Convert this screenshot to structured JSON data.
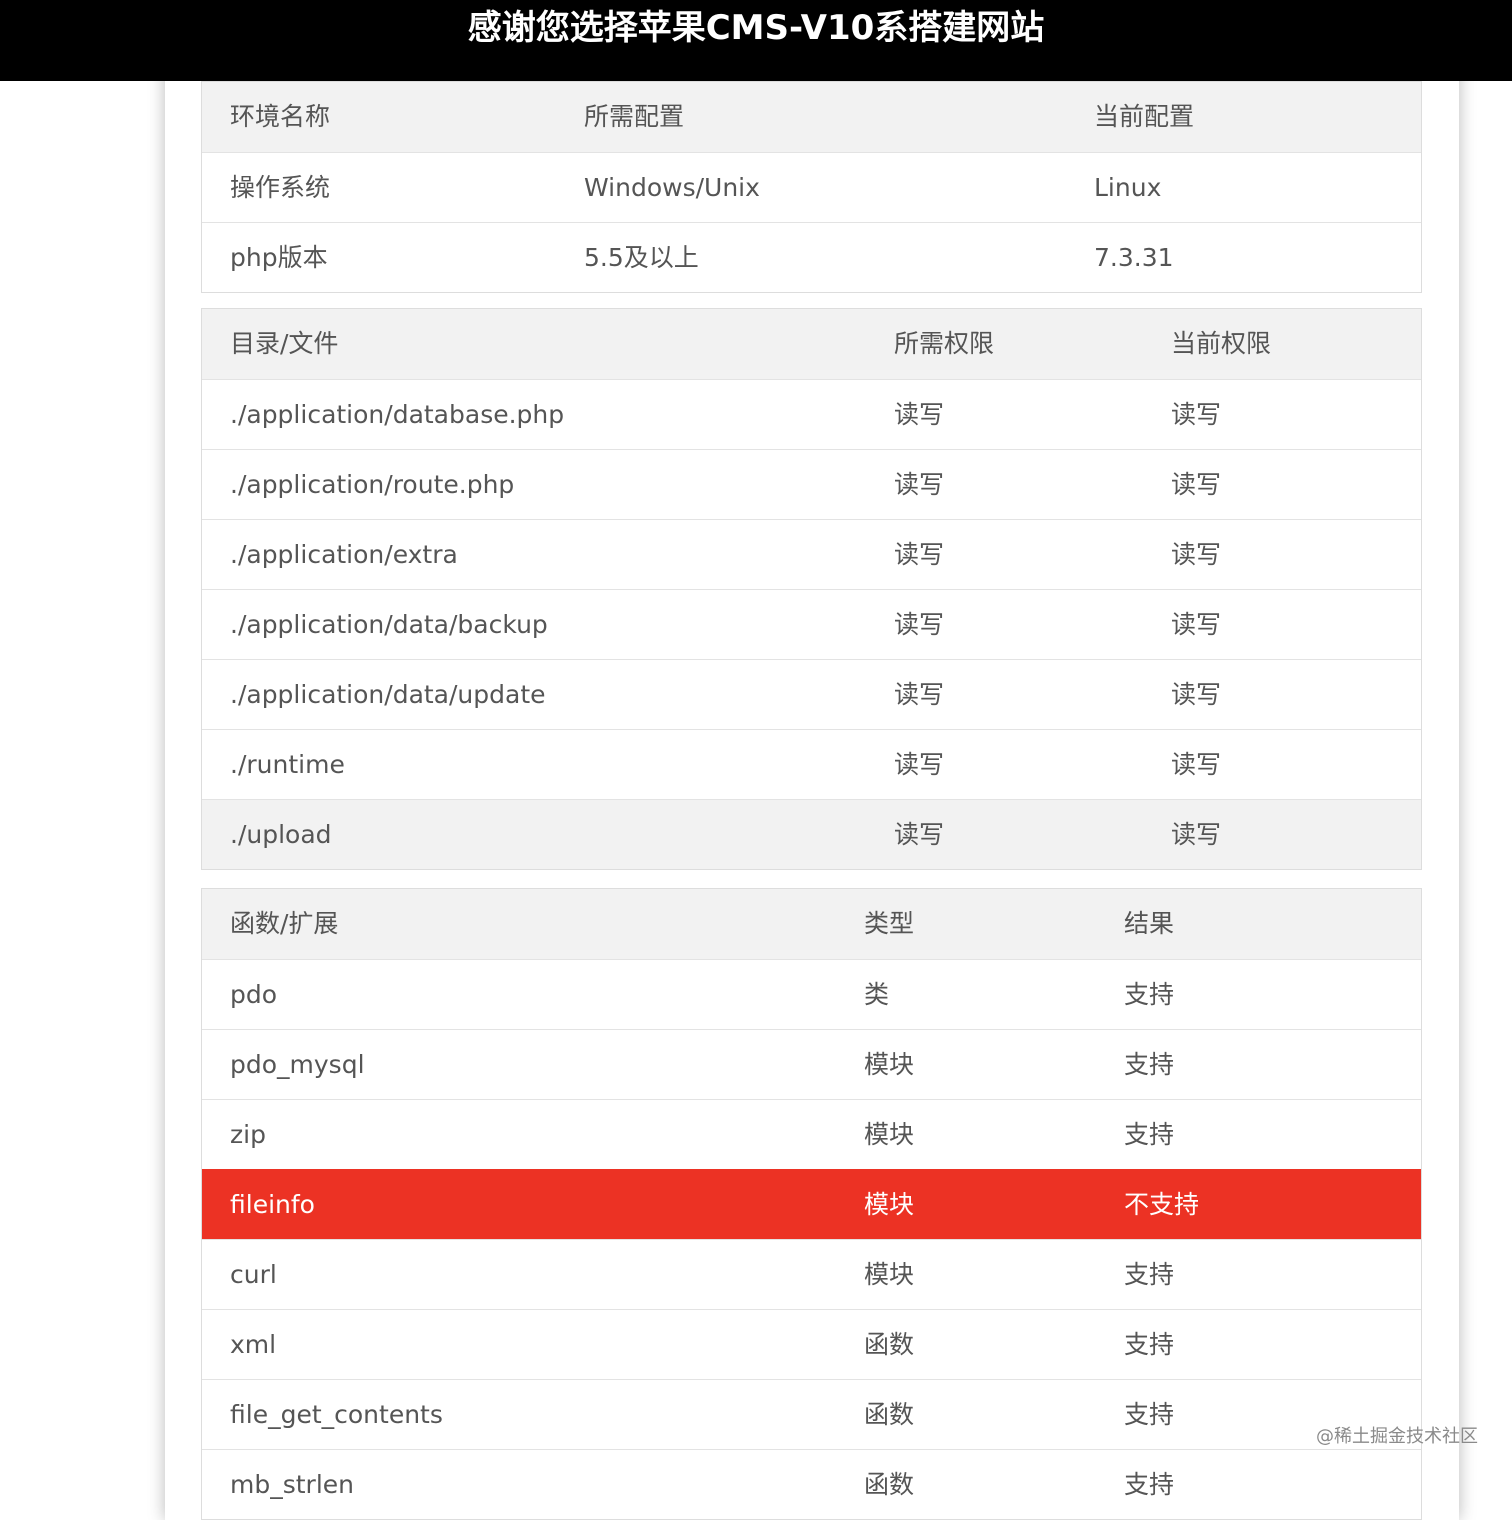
{
  "header": {
    "title": "感谢您选择苹果CMS-V10系搭建网站"
  },
  "env_table": {
    "headers": [
      "环境名称",
      "所需配置",
      "当前配置"
    ],
    "rows": [
      [
        "操作系统",
        "Windows/Unix",
        "Linux"
      ],
      [
        "php版本",
        "5.5及以上",
        "7.3.31"
      ]
    ]
  },
  "dir_table": {
    "headers": [
      "目录/文件",
      "所需权限",
      "当前权限"
    ],
    "rows": [
      [
        "./application/database.php",
        "读写",
        "读写"
      ],
      [
        "./application/route.php",
        "读写",
        "读写"
      ],
      [
        "./application/extra",
        "读写",
        "读写"
      ],
      [
        "./application/data/backup",
        "读写",
        "读写"
      ],
      [
        "./application/data/update",
        "读写",
        "读写"
      ],
      [
        "./runtime",
        "读写",
        "读写"
      ],
      [
        "./upload",
        "读写",
        "读写"
      ]
    ]
  },
  "func_table": {
    "headers": [
      "函数/扩展",
      "类型",
      "结果"
    ],
    "rows": [
      [
        "pdo",
        "类",
        "支持"
      ],
      [
        "pdo_mysql",
        "模块",
        "支持"
      ],
      [
        "zip",
        "模块",
        "支持"
      ],
      [
        "fileinfo",
        "模块",
        "不支持"
      ],
      [
        "curl",
        "模块",
        "支持"
      ],
      [
        "xml",
        "函数",
        "支持"
      ],
      [
        "file_get_contents",
        "函数",
        "支持"
      ],
      [
        "mb_strlen",
        "函数",
        "支持"
      ]
    ]
  },
  "watermark": "@稀土掘金技术社区",
  "colors": {
    "header_bg": "#000000",
    "error_row": "#ec3224",
    "head_row": "#f2f2f2"
  }
}
